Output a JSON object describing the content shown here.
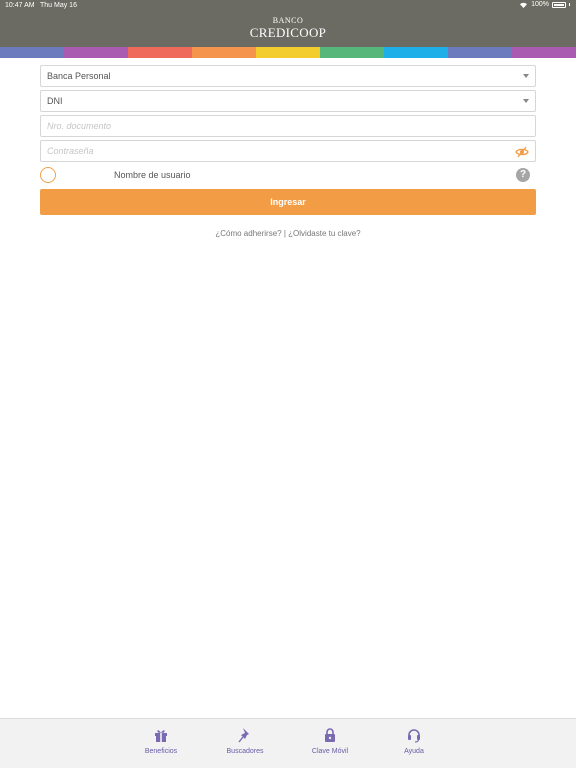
{
  "status_bar": {
    "time": "10:47 AM",
    "date": "Thu May 16",
    "battery": "100%"
  },
  "logo": {
    "top": "BANCO",
    "main": "CREDICOOP"
  },
  "stripe_colors": [
    "#6c7bbd",
    "#a85bb0",
    "#ef6a5a",
    "#f5944c",
    "#f3cc2e",
    "#55b87a",
    "#1eaee8",
    "#6c7bbd",
    "#a85bb0"
  ],
  "form": {
    "account_type": "Banca Personal",
    "document_type": "DNI",
    "document_number_placeholder": "Nro. documento",
    "password_placeholder": "Contraseña",
    "username_label": "Nombre de usuario",
    "help_symbol": "?",
    "submit_label": "Ingresar"
  },
  "links": {
    "how_to_join": "¿Cómo adherirse?",
    "separator": "|",
    "forgot_password": "¿Olvidaste tu clave?"
  },
  "tabbar": {
    "items": [
      {
        "label": "Beneficios",
        "icon": "gift-icon"
      },
      {
        "label": "Buscadores",
        "icon": "pin-icon"
      },
      {
        "label": "Clave Móvil",
        "icon": "lock-icon"
      },
      {
        "label": "Ayuda",
        "icon": "headset-icon"
      }
    ]
  },
  "colors": {
    "header": "#6b6b63",
    "accent": "#f29d45",
    "tab_icon": "#7a6ab2"
  }
}
